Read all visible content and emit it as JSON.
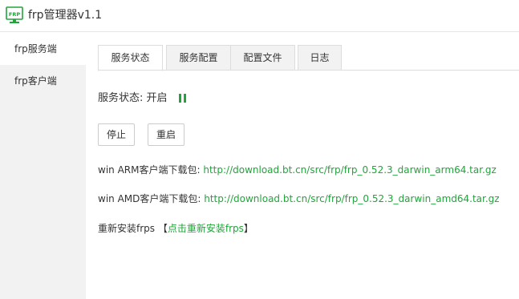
{
  "app": {
    "icon_text": "FRP",
    "title": "frp管理器v1.1"
  },
  "sidebar": {
    "items": [
      {
        "label": "frp服务端",
        "active": true
      },
      {
        "label": "frp客户端",
        "active": false
      }
    ]
  },
  "tabs": [
    {
      "label": "服务状态",
      "active": true
    },
    {
      "label": "服务配置",
      "active": false
    },
    {
      "label": "配置文件",
      "active": false
    },
    {
      "label": "日志",
      "active": false
    }
  ],
  "status": {
    "label": "服务状态: 开启",
    "indicator_color": "#20a53a"
  },
  "buttons": {
    "stop": "停止",
    "restart": "重启"
  },
  "downloads": [
    {
      "label": "win ARM客户端下载包:",
      "url": "http://download.bt.cn/src/frp/frp_0.52.3_darwin_arm64.tar.gz"
    },
    {
      "label": "win AMD客户端下载包:",
      "url": "http://download.bt.cn/src/frp/frp_0.52.3_darwin_amd64.tar.gz"
    }
  ],
  "reinstall": {
    "label": "重新安装frps",
    "bracket_open": "【",
    "link": "点击重新安装frps",
    "bracket_close": "】"
  },
  "colors": {
    "accent": "#20a53a",
    "sidebar_bg": "#f2f2f2"
  }
}
